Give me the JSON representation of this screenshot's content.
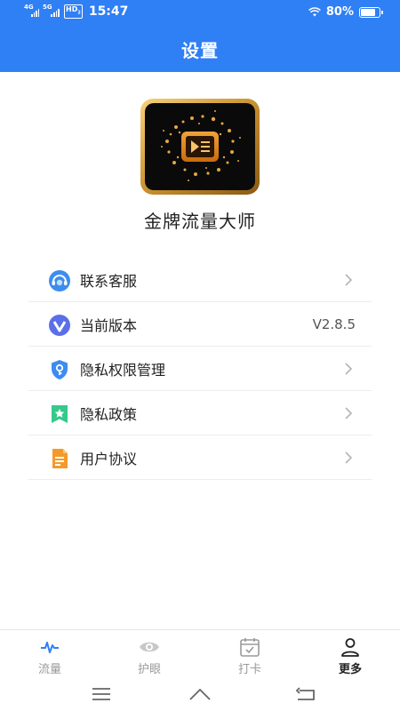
{
  "status_bar": {
    "net1": "4G",
    "net2": "5G",
    "hd": "HD",
    "hd_sub": "2",
    "time": "15:47",
    "battery_pct": "80%",
    "battery_level": 0.8
  },
  "header": {
    "title": "设置",
    "color": "#2f7ff5"
  },
  "app": {
    "name": "金牌流量大师"
  },
  "menu": {
    "items": [
      {
        "label": "联系客服",
        "icon": "customer-service-icon",
        "chevron": true
      },
      {
        "label": "当前版本",
        "icon": "version-icon",
        "value": "V2.8.5",
        "chevron": false
      },
      {
        "label": "隐私权限管理",
        "icon": "privacy-permission-icon",
        "chevron": true
      },
      {
        "label": "隐私政策",
        "icon": "privacy-policy-icon",
        "chevron": true
      },
      {
        "label": "用户协议",
        "icon": "user-agreement-icon",
        "chevron": true
      }
    ]
  },
  "tabs": [
    {
      "label": "流量",
      "icon": "traffic-wave-icon"
    },
    {
      "label": "护眼",
      "icon": "eye-icon"
    },
    {
      "label": "打卡",
      "icon": "calendar-check-icon"
    },
    {
      "label": "更多",
      "icon": "person-icon",
      "selected": true
    }
  ]
}
